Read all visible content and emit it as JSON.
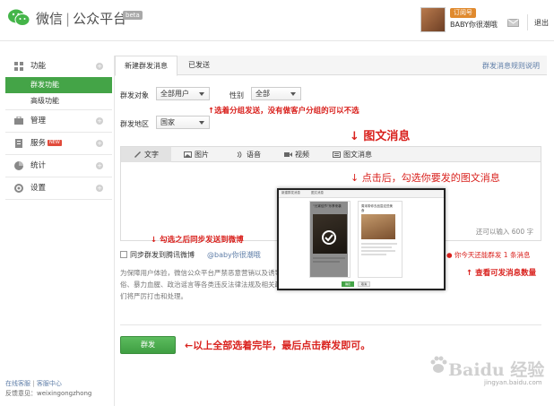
{
  "header": {
    "brand_wechat": "微信",
    "brand_sep": "|",
    "brand_platform": "公众平台",
    "beta": "beta",
    "account_badge": "订阅号",
    "account_name": "BABY你很潮哦",
    "logout": "退出"
  },
  "sidebar": {
    "groups": [
      {
        "label": "功能",
        "icon": "function-icon",
        "items": [
          {
            "label": "群发功能",
            "active": true
          },
          {
            "label": "高级功能",
            "active": false
          }
        ]
      },
      {
        "label": "管理",
        "icon": "manage-icon",
        "items": []
      },
      {
        "label": "服务",
        "icon": "service-icon",
        "new": "NEW",
        "items": []
      },
      {
        "label": "统计",
        "icon": "stats-icon",
        "items": []
      },
      {
        "label": "设置",
        "icon": "settings-icon",
        "items": []
      }
    ],
    "footer": {
      "online_support": "在线客服",
      "separator": "|",
      "support_center": "客服中心",
      "feedback": "反馈意见：weixingongzhong"
    }
  },
  "main": {
    "tabs": [
      {
        "label": "新建群发消息",
        "active": true
      },
      {
        "label": "已发送",
        "active": false
      }
    ],
    "rules_link": "群发消息规则说明",
    "target_label": "群发对象",
    "target_value": "全部用户",
    "gender_label": "性别",
    "gender_value": "全部",
    "region_label": "群发地区",
    "region_value": "国家",
    "editor_tabs": [
      {
        "label": "文字",
        "icon": "text-icon",
        "active": true
      },
      {
        "label": "图片",
        "icon": "image-icon",
        "active": false
      },
      {
        "label": "语音",
        "icon": "voice-icon",
        "active": false
      },
      {
        "label": "视频",
        "icon": "video-icon",
        "active": false
      },
      {
        "label": "图文消息",
        "icon": "news-icon",
        "active": false
      }
    ],
    "counter": "还可以输入 600 字",
    "sync_label": "同步群发到腾讯微博",
    "sync_account": "@baby你很潮哦",
    "sent_today": "● 你今天还能群发 1 条消息",
    "notice": "为保障用户体验，微信公众平台严禁恶意营销以及诱导分享朋友圈，严禁发布色情低俗、暴力血腥、政治谣言等各类违反法律法规及相关政策规定的信息。一旦发现，我们将严厉打击和处理。",
    "send_button": "群发"
  },
  "annotations": {
    "group_hint": "↑选着分组发送，没有做客户分组的可以不选",
    "news_title": "↓ 图文消息",
    "pick_news": "↓ 点击后，勾选你要发的图文消息",
    "weibo_hint": "↓ 勾选之后同步发送到微博",
    "count_hint": "↑ 查看可发消息数量",
    "final_hint": "←以上全部选着完毕，最后点击群发即可。"
  },
  "popup": {
    "tab1": "新建群发消息",
    "tab2": "图文消息",
    "card1_title": "“元宵佳节”乐享来袭",
    "card2_title": "周末带你去品尝这些美食",
    "ok": "确定",
    "cancel": "取消"
  },
  "watermark": {
    "text": "Baidu 经验",
    "sub": "jingyan.baidu.com"
  },
  "colors": {
    "green": "#44a447",
    "red_annotation": "#d9211d",
    "link_blue": "#5f7ea8"
  }
}
